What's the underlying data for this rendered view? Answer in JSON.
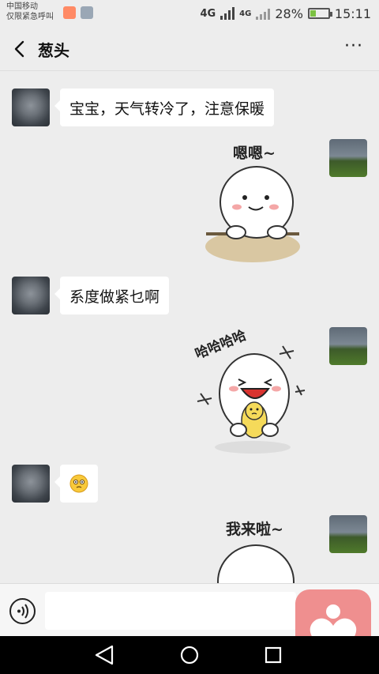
{
  "status_bar": {
    "carrier_line1": "中国移动",
    "carrier_line2": "仅限紧急呼叫",
    "network": "4G",
    "network_small": "4G",
    "battery": "28%",
    "battery_level": 0.28,
    "time": "15:11"
  },
  "header": {
    "title": "葱头",
    "more": "···"
  },
  "messages": [
    {
      "side": "left",
      "type": "text",
      "text": "宝宝，天气转冷了，注意保暖"
    },
    {
      "side": "right",
      "type": "sticker",
      "caption": "嗯嗯~"
    },
    {
      "side": "left",
      "type": "text",
      "text": "系度做紧乜啊"
    },
    {
      "side": "right",
      "type": "sticker",
      "caption": "哈哈哈哈"
    },
    {
      "side": "left",
      "type": "emoji",
      "icon": "confused-face-emoji"
    },
    {
      "side": "right",
      "type": "sticker",
      "caption": "我来啦~"
    }
  ],
  "input_bar": {
    "message_value": ""
  },
  "colors": {
    "background": "#ededed",
    "bubble": "#ffffff",
    "overlay_app": "#ef8f8f",
    "battery_fill": "#7bc142"
  }
}
